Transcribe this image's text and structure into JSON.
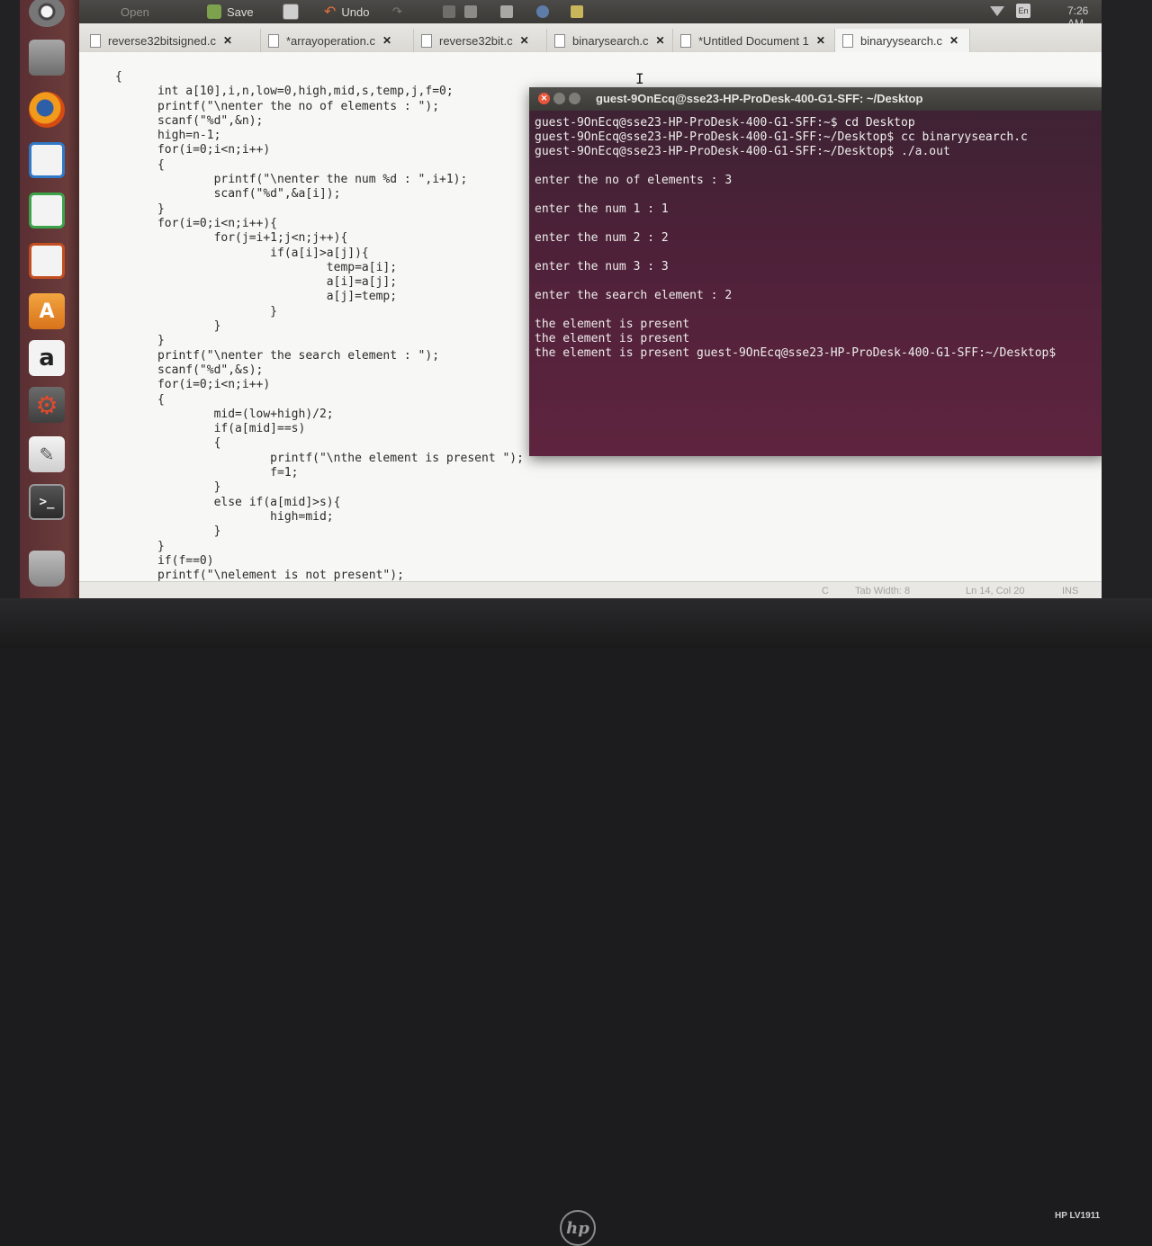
{
  "monitor": {
    "brand_logo": "hp",
    "model": "HP LV1911"
  },
  "top_panel": {
    "open_label": "Open",
    "save_label": "Save",
    "undo_label": "Undo",
    "clock": "7:26 AM",
    "keyboard_layout": "En"
  },
  "tabs": [
    {
      "label": "reverse32bitsigned.c"
    },
    {
      "label": "*arrayoperation.c"
    },
    {
      "label": "reverse32bit.c"
    },
    {
      "label": "binarysearch.c"
    },
    {
      "label": "*Untitled Document 1"
    },
    {
      "label": "binaryysearch.c"
    }
  ],
  "editor": {
    "code_lines": [
      "{",
      "      int a[10],i,n,low=0,high,mid,s,temp,j,f=0;",
      "      printf(\"\\nenter the no of elements : \");",
      "      scanf(\"%d\",&n);",
      "      high=n-1;",
      "      for(i=0;i<n;i++)",
      "      {",
      "              printf(\"\\nenter the num %d : \",i+1);",
      "              scanf(\"%d\",&a[i]);",
      "      }",
      "      for(i=0;i<n;i++){",
      "              for(j=i+1;j<n;j++){",
      "                      if(a[i]>a[j]){",
      "                              temp=a[i];",
      "                              a[i]=a[j];",
      "                              a[j]=temp;",
      "                      }",
      "              }",
      "      }",
      "      printf(\"\\nenter the search element : \");",
      "      scanf(\"%d\",&s);",
      "      for(i=0;i<n;i++)",
      "      {",
      "              mid=(low+high)/2;",
      "              if(a[mid]==s)",
      "              {",
      "                      printf(\"\\nthe element is present \");",
      "                      f=1;",
      "              }",
      "              else if(a[mid]>s){",
      "                      high=mid;",
      "              }",
      "      }",
      "      if(f==0)",
      "      printf(\"\\nelement is not present\");",
      "}"
    ]
  },
  "statusbar": {
    "language": "C",
    "tab_width": "Tab Width: 8",
    "position": "Ln 14, Col 20",
    "mode": "INS"
  },
  "terminal": {
    "title": "guest-9OnEcq@sse23-HP-ProDesk-400-G1-SFF: ~/Desktop",
    "lines": [
      "guest-9OnEcq@sse23-HP-ProDesk-400-G1-SFF:~$ cd Desktop",
      "guest-9OnEcq@sse23-HP-ProDesk-400-G1-SFF:~/Desktop$ cc binaryysearch.c",
      "guest-9OnEcq@sse23-HP-ProDesk-400-G1-SFF:~/Desktop$ ./a.out",
      "",
      "enter the no of elements : 3",
      "",
      "enter the num 1 : 1",
      "",
      "enter the num 2 : 2",
      "",
      "enter the num 3 : 3",
      "",
      "enter the search element : 2",
      "",
      "the element is present",
      "the element is present",
      "the element is present guest-9OnEcq@sse23-HP-ProDesk-400-G1-SFF:~/Desktop$"
    ]
  }
}
